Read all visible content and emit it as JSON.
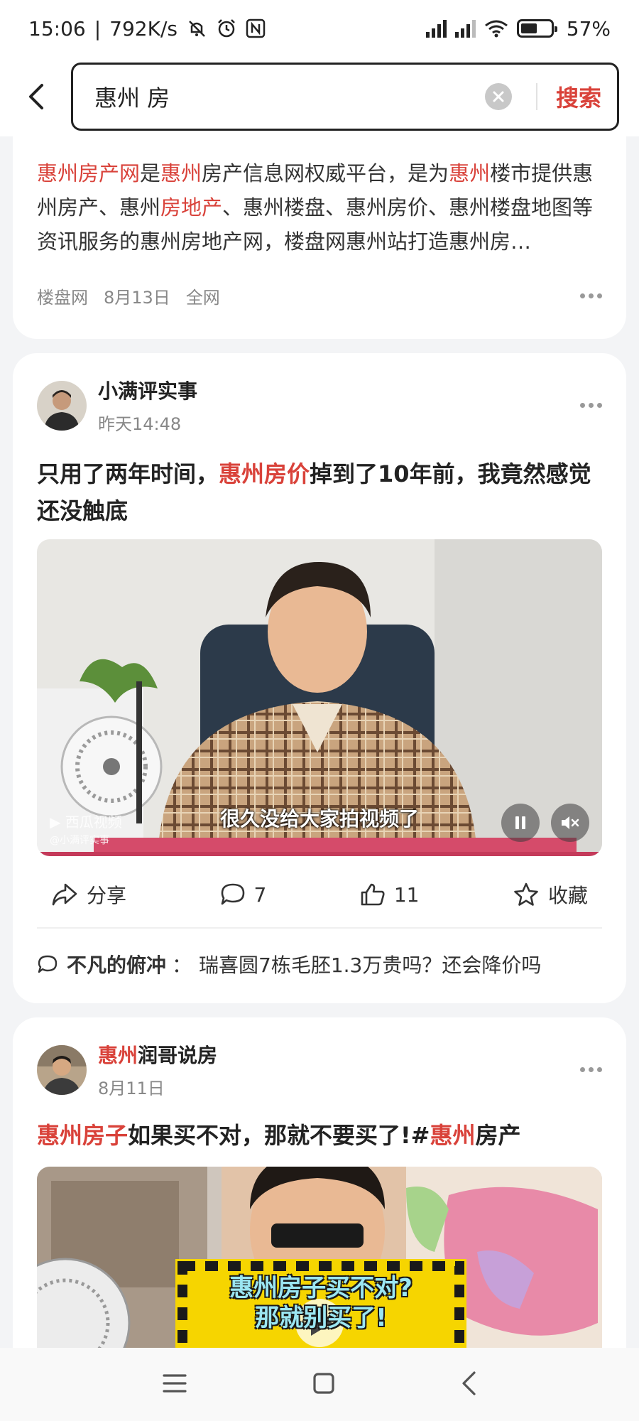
{
  "status_bar": {
    "time": "15:06",
    "speed": "792K/s",
    "battery": "57%",
    "icons": [
      "mute-icon",
      "alarm-icon",
      "nfc-icon",
      "signal-hd-1-icon",
      "signal-hd-2-icon",
      "wifi-icon",
      "battery-icon"
    ]
  },
  "search": {
    "query": "惠州 房",
    "button_label": "搜索"
  },
  "result1": {
    "snippet_parts": {
      "a": "惠州房产网",
      "b": "是",
      "c": "惠州",
      "d": "房产信息网权威平台，是为",
      "e": "惠州",
      "f": "楼市提供惠州房产、惠州",
      "g": "房地产",
      "h": "、惠州楼盘、惠州房价、惠州楼盘地图等资讯服务的惠州房地产网，楼盘网惠州站打造惠州房…"
    },
    "source": "楼盘网",
    "date": "8月13日",
    "scope": "全网"
  },
  "post1": {
    "author": "小满评实事",
    "time": "昨天14:48",
    "title_parts": {
      "a": "只用了两年时间，",
      "b": "惠州房价",
      "c": "掉到了10年前，我竟然感觉还没触底"
    },
    "video_caption": "很久没给大家拍视频了",
    "watermark": "西瓜视频",
    "watermark_user": "@小满评实事",
    "actions": {
      "share": "分享",
      "comments": "7",
      "likes": "11",
      "favorite": "收藏"
    },
    "comment_user": "不凡的俯冲",
    "comment_sep": "：",
    "comment_text": "瑞喜圆7栋毛胚1.3万贵吗？还会降价吗"
  },
  "post2": {
    "author_hl": "惠州",
    "author_rest": "润哥说房",
    "time": "8月11日",
    "title_parts": {
      "a": "惠州房子",
      "b": "如果买不对，那就不要买了!#",
      "c": "惠州",
      "d": "房产"
    },
    "video_text_1": "惠州房子买不对?",
    "video_text_2": "那就别买了!"
  },
  "colors": {
    "highlight": "#d9423a",
    "text": "#222222",
    "background": "#f3f4f6"
  }
}
